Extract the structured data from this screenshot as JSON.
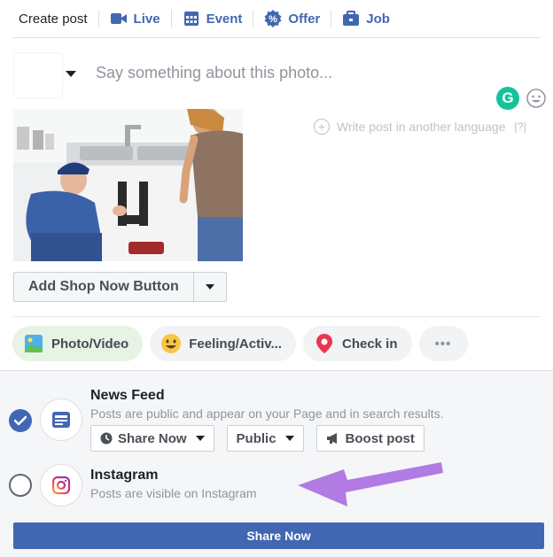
{
  "tabs": [
    {
      "label": "Create post",
      "icon": "none"
    },
    {
      "label": "Live",
      "icon": "video-camera-icon"
    },
    {
      "label": "Event",
      "icon": "calendar-icon"
    },
    {
      "label": "Offer",
      "icon": "percent-badge-icon"
    },
    {
      "label": "Job",
      "icon": "briefcase-icon"
    }
  ],
  "composer": {
    "placeholder": "Say something about this photo...",
    "grammarly_letter": "G",
    "translate_label": "Write post in another language",
    "translate_help": "[?]"
  },
  "shop_button": {
    "label": "Add Shop Now Button"
  },
  "pills": [
    {
      "label": "Photo/Video",
      "icon": "photo-icon"
    },
    {
      "label": "Feeling/Activ...",
      "icon": "smiley-icon"
    },
    {
      "label": "Check in",
      "icon": "location-pin-icon"
    },
    {
      "label": "•••",
      "icon": "more-icon"
    }
  ],
  "destinations": {
    "news_feed": {
      "title": "News Feed",
      "subtitle": "Posts are public and appear on your Page and in search results.",
      "checked": true,
      "controls": {
        "schedule": "Share Now",
        "audience": "Public",
        "boost": "Boost post"
      }
    },
    "instagram": {
      "title": "Instagram",
      "subtitle": "Posts are visible on Instagram",
      "checked": false
    }
  },
  "submit": {
    "label": "Share Now"
  },
  "colors": {
    "brand": "#4267b2",
    "grammarly": "#15c39a",
    "annotation_arrow": "#b27be3"
  }
}
